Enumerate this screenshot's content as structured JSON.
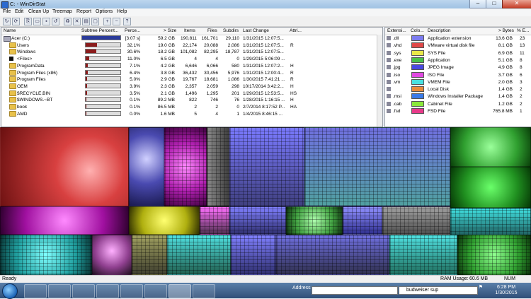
{
  "window": {
    "title": "C: - WinDirStat",
    "min": "–",
    "max": "□",
    "close": "✕"
  },
  "menu": [
    "File",
    "Edit",
    "Clean Up",
    "Treemap",
    "Report",
    "Options",
    "Help"
  ],
  "toolbar": [
    "refresh-icon",
    "refresh-all-icon",
    "copy-path-icon",
    "explorer-icon",
    "cmd-icon",
    "refresh-selected-icon",
    "delete-recycle-icon",
    "delete-icon",
    "properties-icon",
    "select-all-icon",
    "zoom-in-icon",
    "zoom-out-icon",
    "help-icon"
  ],
  "dir": {
    "headers": [
      "Name",
      "Subtree Percent...",
      "Perce...",
      "> Size",
      "Items",
      "Files",
      "Subdirs",
      "Last Change",
      "Attri..."
    ],
    "rows": [
      {
        "name": "Acer (C:)",
        "pct": "[3:07 s]",
        "size": "59.2 GB",
        "items": "190,811",
        "files": "161,701",
        "subdirs": "29,110",
        "date": "1/31/2015  12:07:5...",
        "attr": "",
        "bar": 1.0,
        "icon": "drive"
      },
      {
        "name": "Users",
        "pct": "32.1%",
        "size": "19.0 GB",
        "items": "22,174",
        "files": "20,088",
        "subdirs": "2,086",
        "date": "1/31/2015  12:07:5...",
        "attr": "R",
        "bar": 0.321,
        "icon": "folder"
      },
      {
        "name": "Windows",
        "pct": "30.6%",
        "size": "18.2 GB",
        "items": "101,082",
        "files": "82,295",
        "subdirs": "18,787",
        "date": "1/31/2015  12:07:5...",
        "attr": "",
        "bar": 0.306,
        "icon": "folder"
      },
      {
        "name": "<Files>",
        "pct": "11.0%",
        "size": "6.5 GB",
        "items": "4",
        "files": "4",
        "subdirs": "0",
        "date": "1/29/2015  5:06:09 ...",
        "attr": "",
        "bar": 0.11,
        "icon": "files"
      },
      {
        "name": "ProgramData",
        "pct": "7.1%",
        "size": "4.2 GB",
        "items": "6,646",
        "files": "6,066",
        "subdirs": "580",
        "date": "1/31/2015  12:07:2...",
        "attr": "H",
        "bar": 0.071,
        "icon": "folder"
      },
      {
        "name": "Program Files (x86)",
        "pct": "6.4%",
        "size": "3.8 GB",
        "items": "36,432",
        "files": "30,456",
        "subdirs": "5,976",
        "date": "1/31/2015  12:00:4...",
        "attr": "R",
        "bar": 0.064,
        "icon": "folder"
      },
      {
        "name": "Program Files",
        "pct": "5.0%",
        "size": "2.9 GB",
        "items": "19,767",
        "files": "18,681",
        "subdirs": "1,086",
        "date": "1/30/2015  7:41:21 ...",
        "attr": "R",
        "bar": 0.05,
        "icon": "folder"
      },
      {
        "name": "OEM",
        "pct": "3.9%",
        "size": "2.3 GB",
        "items": "2,357",
        "files": "2,059",
        "subdirs": "298",
        "date": "10/17/2014  3:42:2...",
        "attr": "H",
        "bar": 0.039,
        "icon": "folder"
      },
      {
        "name": "$RECYCLE.BIN",
        "pct": "3.5%",
        "size": "2.1 GB",
        "items": "1,496",
        "files": "1,295",
        "subdirs": "201",
        "date": "1/29/2015  12:53:5...",
        "attr": "HS",
        "bar": 0.035,
        "icon": "folder"
      },
      {
        "name": "$WINDOWS.~BT",
        "pct": "0.1%",
        "size": "89.2 MB",
        "items": "822",
        "files": "746",
        "subdirs": "76",
        "date": "1/28/2015  1:16:15 ...",
        "attr": "H",
        "bar": 0.006,
        "icon": "folder"
      },
      {
        "name": "book",
        "pct": "0.1%",
        "size": "86.5 MB",
        "items": "2",
        "files": "2",
        "subdirs": "0",
        "date": "2/7/2014  8:17:52 P...",
        "attr": "HA",
        "bar": 0.006,
        "icon": "folder"
      },
      {
        "name": "AMD",
        "pct": "0.0%",
        "size": "1.6 MB",
        "items": "5",
        "files": "4",
        "subdirs": "1",
        "date": "1/4/2015  8:46:15 ...",
        "attr": "",
        "bar": 0.002,
        "icon": "folder"
      }
    ]
  },
  "ext": {
    "headers": [
      "Extensi...",
      "Colo...",
      "Description",
      "> Bytes",
      "% E..."
    ],
    "rows": [
      {
        "ext": ".dll",
        "color": "#7b7bf0",
        "desc": "Application extension",
        "bytes": "13.6 GB",
        "pct": "23"
      },
      {
        "ext": ".vhd",
        "color": "#e04848",
        "desc": "VMware virtual disk file",
        "bytes": "8.1 GB",
        "pct": "13"
      },
      {
        "ext": ".sys",
        "color": "#e8e84a",
        "desc": "SYS File",
        "bytes": "6.9 GB",
        "pct": "11"
      },
      {
        "ext": ".exe",
        "color": "#48c048",
        "desc": "Application",
        "bytes": "5.1 GB",
        "pct": "8"
      },
      {
        "ext": ".jpg",
        "color": "#4848e0",
        "desc": "JPEG Image",
        "bytes": "4.9 GB",
        "pct": "8"
      },
      {
        "ext": ".iso",
        "color": "#e048e0",
        "desc": "ISO File",
        "bytes": "3.7 GB",
        "pct": "6"
      },
      {
        "ext": ".vm",
        "color": "#48e0e0",
        "desc": "VMEM File",
        "bytes": "2.0 GB",
        "pct": "3"
      },
      {
        "ext": "",
        "color": "#e88a3a",
        "desc": "Local Disk",
        "bytes": "1.4 GB",
        "pct": "2"
      },
      {
        "ext": ".msi",
        "color": "#3a7ae8",
        "desc": "Windows Installer Package",
        "bytes": "1.4 GB",
        "pct": "2"
      },
      {
        "ext": ".cab",
        "color": "#8ae83a",
        "desc": "Cabinet File",
        "bytes": "1.2 GB",
        "pct": "2"
      },
      {
        "ext": ".fsd",
        "color": "#e83a8a",
        "desc": "FSD File",
        "bytes": "765.8 MB",
        "pct": "1"
      }
    ]
  },
  "status": {
    "left": "Ready",
    "ram_label": "RAM Usage:",
    "ram_value": "60.6 MB",
    "num": "NUM"
  },
  "taskbar": {
    "address_label": "Address",
    "search_text": "budweiser sup",
    "time": "6:28 PM",
    "date": "1/30/2015"
  }
}
